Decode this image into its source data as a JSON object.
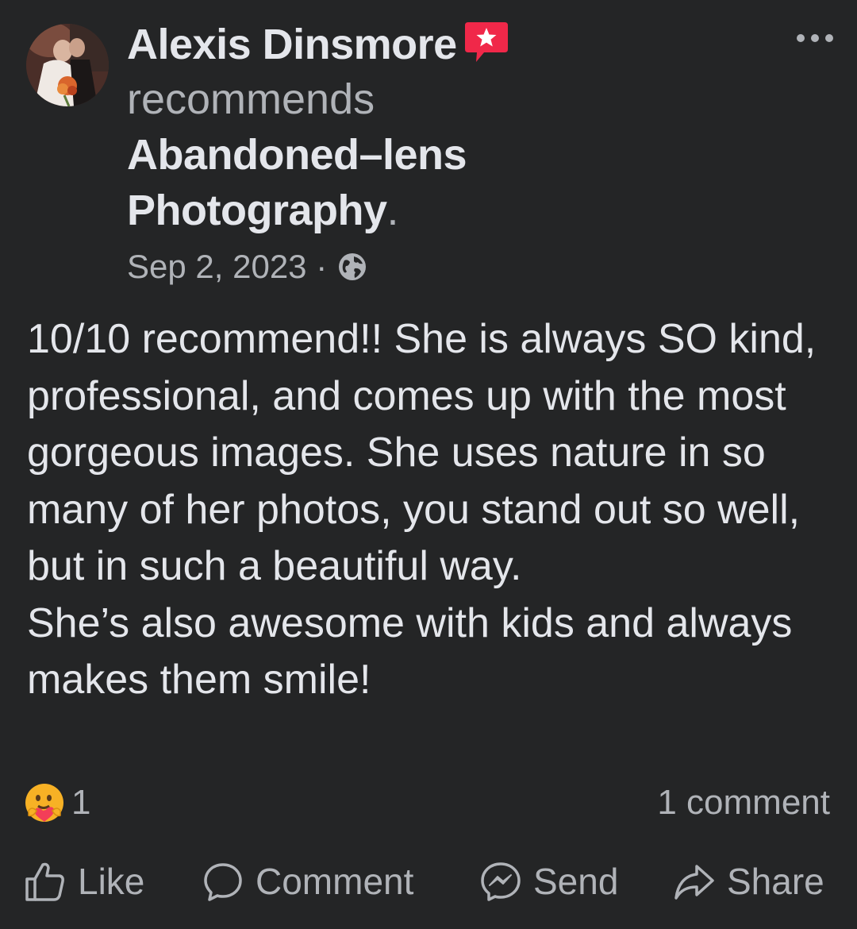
{
  "post": {
    "author": "Alexis Dinsmore",
    "action": "recommends",
    "page_name_line1": "Abandoned–lens",
    "page_name_line2": "Photography",
    "page_name_period": ".",
    "date": "Sep 2, 2023",
    "date_separator": " · ",
    "body": "10/10 recommend!! She is always SO kind, professional, and comes up with the most gorgeous images. She uses nature in so many of her photos, you stand out so well, but in such a beautiful way.\nShe’s also awesome with kids and always makes them smile!",
    "reaction_count": "1",
    "comment_count": "1 comment"
  },
  "actions": {
    "like": "Like",
    "comment": "Comment",
    "send": "Send",
    "share": "Share"
  },
  "colors": {
    "background": "#242526",
    "primary_text": "#e4e6eb",
    "secondary_text": "#b0b3b8",
    "badge": "#f02849"
  },
  "icons": {
    "badge": "recommendation-star-icon",
    "privacy": "globe-icon",
    "menu": "more-options-icon",
    "reaction": "care-emoji-icon",
    "like": "thumbs-up-icon",
    "comment": "speech-bubble-icon",
    "send": "messenger-icon",
    "share": "share-arrow-icon"
  }
}
